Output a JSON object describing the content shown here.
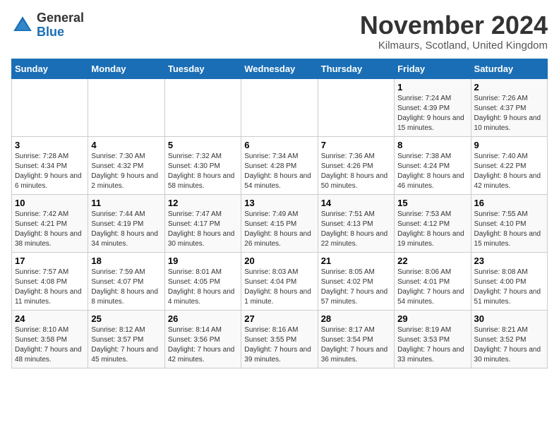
{
  "header": {
    "logo_general": "General",
    "logo_blue": "Blue",
    "month_title": "November 2024",
    "location": "Kilmaurs, Scotland, United Kingdom"
  },
  "weekdays": [
    "Sunday",
    "Monday",
    "Tuesday",
    "Wednesday",
    "Thursday",
    "Friday",
    "Saturday"
  ],
  "weeks": [
    [
      {
        "day": "",
        "info": ""
      },
      {
        "day": "",
        "info": ""
      },
      {
        "day": "",
        "info": ""
      },
      {
        "day": "",
        "info": ""
      },
      {
        "day": "",
        "info": ""
      },
      {
        "day": "1",
        "info": "Sunrise: 7:24 AM\nSunset: 4:39 PM\nDaylight: 9 hours and 15 minutes."
      },
      {
        "day": "2",
        "info": "Sunrise: 7:26 AM\nSunset: 4:37 PM\nDaylight: 9 hours and 10 minutes."
      }
    ],
    [
      {
        "day": "3",
        "info": "Sunrise: 7:28 AM\nSunset: 4:34 PM\nDaylight: 9 hours and 6 minutes."
      },
      {
        "day": "4",
        "info": "Sunrise: 7:30 AM\nSunset: 4:32 PM\nDaylight: 9 hours and 2 minutes."
      },
      {
        "day": "5",
        "info": "Sunrise: 7:32 AM\nSunset: 4:30 PM\nDaylight: 8 hours and 58 minutes."
      },
      {
        "day": "6",
        "info": "Sunrise: 7:34 AM\nSunset: 4:28 PM\nDaylight: 8 hours and 54 minutes."
      },
      {
        "day": "7",
        "info": "Sunrise: 7:36 AM\nSunset: 4:26 PM\nDaylight: 8 hours and 50 minutes."
      },
      {
        "day": "8",
        "info": "Sunrise: 7:38 AM\nSunset: 4:24 PM\nDaylight: 8 hours and 46 minutes."
      },
      {
        "day": "9",
        "info": "Sunrise: 7:40 AM\nSunset: 4:22 PM\nDaylight: 8 hours and 42 minutes."
      }
    ],
    [
      {
        "day": "10",
        "info": "Sunrise: 7:42 AM\nSunset: 4:21 PM\nDaylight: 8 hours and 38 minutes."
      },
      {
        "day": "11",
        "info": "Sunrise: 7:44 AM\nSunset: 4:19 PM\nDaylight: 8 hours and 34 minutes."
      },
      {
        "day": "12",
        "info": "Sunrise: 7:47 AM\nSunset: 4:17 PM\nDaylight: 8 hours and 30 minutes."
      },
      {
        "day": "13",
        "info": "Sunrise: 7:49 AM\nSunset: 4:15 PM\nDaylight: 8 hours and 26 minutes."
      },
      {
        "day": "14",
        "info": "Sunrise: 7:51 AM\nSunset: 4:13 PM\nDaylight: 8 hours and 22 minutes."
      },
      {
        "day": "15",
        "info": "Sunrise: 7:53 AM\nSunset: 4:12 PM\nDaylight: 8 hours and 19 minutes."
      },
      {
        "day": "16",
        "info": "Sunrise: 7:55 AM\nSunset: 4:10 PM\nDaylight: 8 hours and 15 minutes."
      }
    ],
    [
      {
        "day": "17",
        "info": "Sunrise: 7:57 AM\nSunset: 4:08 PM\nDaylight: 8 hours and 11 minutes."
      },
      {
        "day": "18",
        "info": "Sunrise: 7:59 AM\nSunset: 4:07 PM\nDaylight: 8 hours and 8 minutes."
      },
      {
        "day": "19",
        "info": "Sunrise: 8:01 AM\nSunset: 4:05 PM\nDaylight: 8 hours and 4 minutes."
      },
      {
        "day": "20",
        "info": "Sunrise: 8:03 AM\nSunset: 4:04 PM\nDaylight: 8 hours and 1 minute."
      },
      {
        "day": "21",
        "info": "Sunrise: 8:05 AM\nSunset: 4:02 PM\nDaylight: 7 hours and 57 minutes."
      },
      {
        "day": "22",
        "info": "Sunrise: 8:06 AM\nSunset: 4:01 PM\nDaylight: 7 hours and 54 minutes."
      },
      {
        "day": "23",
        "info": "Sunrise: 8:08 AM\nSunset: 4:00 PM\nDaylight: 7 hours and 51 minutes."
      }
    ],
    [
      {
        "day": "24",
        "info": "Sunrise: 8:10 AM\nSunset: 3:58 PM\nDaylight: 7 hours and 48 minutes."
      },
      {
        "day": "25",
        "info": "Sunrise: 8:12 AM\nSunset: 3:57 PM\nDaylight: 7 hours and 45 minutes."
      },
      {
        "day": "26",
        "info": "Sunrise: 8:14 AM\nSunset: 3:56 PM\nDaylight: 7 hours and 42 minutes."
      },
      {
        "day": "27",
        "info": "Sunrise: 8:16 AM\nSunset: 3:55 PM\nDaylight: 7 hours and 39 minutes."
      },
      {
        "day": "28",
        "info": "Sunrise: 8:17 AM\nSunset: 3:54 PM\nDaylight: 7 hours and 36 minutes."
      },
      {
        "day": "29",
        "info": "Sunrise: 8:19 AM\nSunset: 3:53 PM\nDaylight: 7 hours and 33 minutes."
      },
      {
        "day": "30",
        "info": "Sunrise: 8:21 AM\nSunset: 3:52 PM\nDaylight: 7 hours and 30 minutes."
      }
    ]
  ]
}
